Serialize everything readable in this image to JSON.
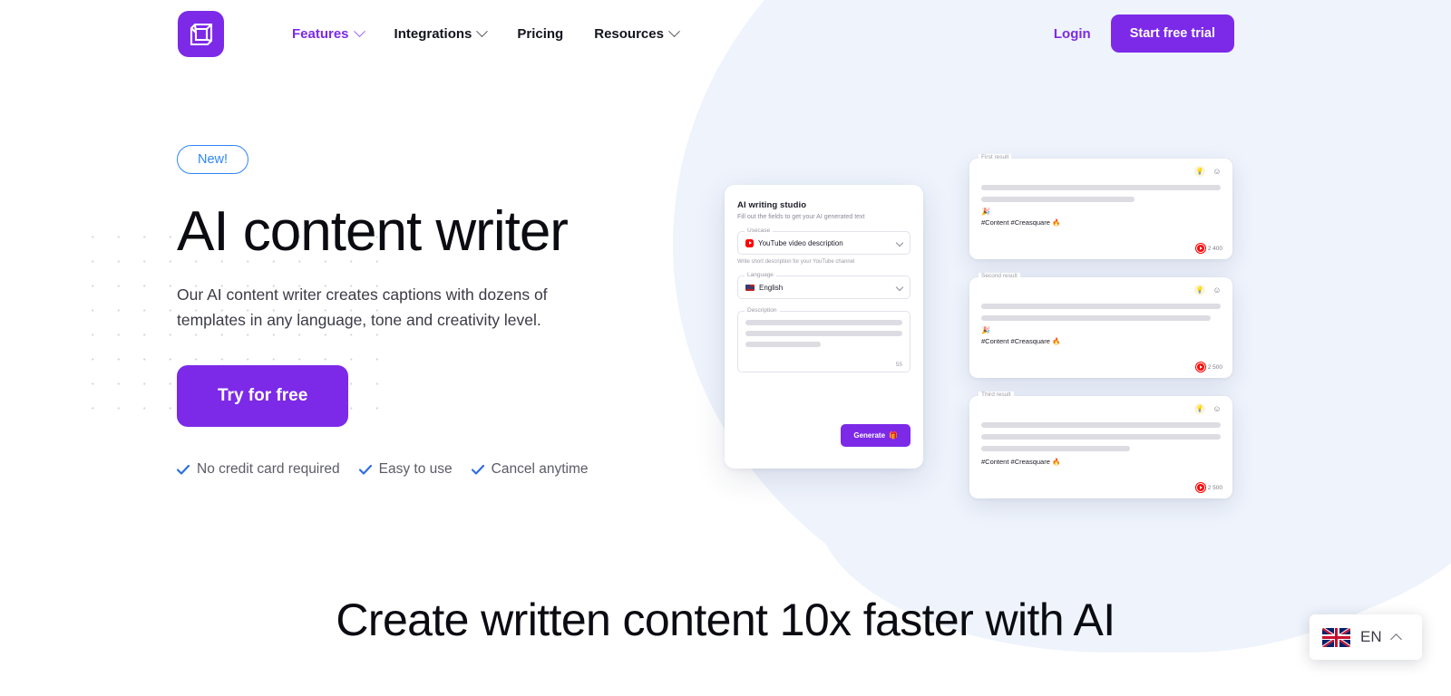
{
  "header": {
    "logo_name": "creasquare-logo",
    "nav": [
      {
        "label": "Features",
        "has_chevron": true,
        "active": true
      },
      {
        "label": "Integrations",
        "has_chevron": true,
        "active": false
      },
      {
        "label": "Pricing",
        "has_chevron": false,
        "active": false
      },
      {
        "label": "Resources",
        "has_chevron": true,
        "active": false
      }
    ],
    "login_label": "Login",
    "trial_label": "Start free trial",
    "accent_color": "#7c2ae8"
  },
  "hero": {
    "badge": "New!",
    "badge_color": "#2f86f6",
    "title": "AI content writer",
    "subtitle": "Our AI content writer creates captions with dozens of templates in any language, tone and creativity level.",
    "cta_label": "Try for free",
    "checks": [
      "No credit card required",
      "Easy to use",
      "Cancel anytime"
    ],
    "check_color": "#2f6fe0"
  },
  "studio": {
    "title": "AI writing studio",
    "description": "Fill out the fields to get your AI generated text",
    "usecase": {
      "label": "Usecase",
      "value": "YouTube video description",
      "icon": "youtube-icon",
      "hint": "Write short description for your YouTube channel"
    },
    "language": {
      "label": "Language",
      "value": "English",
      "icon": "flag-us-icon"
    },
    "description_field": {
      "label": "Description",
      "char_count": "55"
    },
    "generate_label": "Generate",
    "generate_icon": "🎁"
  },
  "results": [
    {
      "label": "First result",
      "bars": [
        100,
        64
      ],
      "emoji": "🎉",
      "tags": "#Content #Creasquare 🔥",
      "count": "2 400",
      "icons": [
        "bulb-icon",
        "smiley-icon"
      ],
      "platform_icon": "youtube-icon"
    },
    {
      "label": "Second result",
      "bars": [
        100,
        96
      ],
      "emoji": "🎉",
      "tags": "#Content #Creasquare 🔥",
      "count": "2 500",
      "icons": [
        "bulb-icon",
        "smiley-icon"
      ],
      "platform_icon": "youtube-icon"
    },
    {
      "label": "Third result",
      "bars": [
        100,
        100,
        62
      ],
      "emoji": "",
      "tags": "#Content #Creasquare 🔥",
      "count": "2 500",
      "icons": [
        "bulb-icon",
        "smiley-icon"
      ],
      "platform_icon": "youtube-icon"
    }
  ],
  "bottom": {
    "heading": "Create written content 10x faster with AI"
  },
  "language_widget": {
    "code": "EN",
    "flag": "flag-uk-icon",
    "chevron": "chevron-up-icon"
  }
}
